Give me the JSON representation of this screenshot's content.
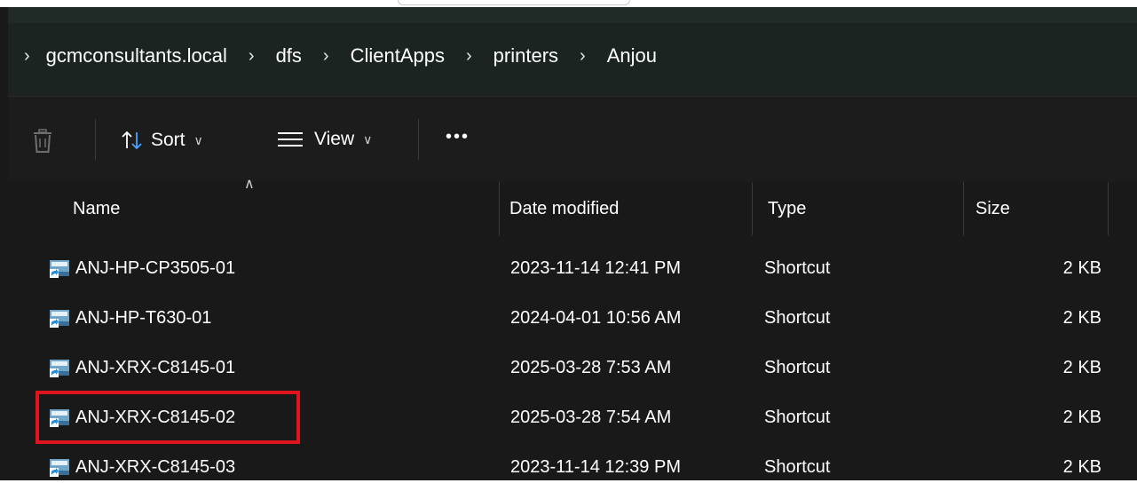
{
  "breadcrumb": {
    "segments": [
      "gcmconsultants.local",
      "dfs",
      "ClientApps",
      "printers",
      "Anjou"
    ]
  },
  "toolbar": {
    "sort_label": "Sort",
    "view_label": "View",
    "more_label": "•••"
  },
  "file_list": {
    "columns": {
      "name": "Name",
      "date": "Date modified",
      "type": "Type",
      "size": "Size"
    },
    "rows": [
      {
        "name": "ANJ-HP-CP3505-01",
        "date": "2023-11-14 12:41 PM",
        "type": "Shortcut",
        "size": "2 KB"
      },
      {
        "name": "ANJ-HP-T630-01",
        "date": "2024-04-01 10:56 AM",
        "type": "Shortcut",
        "size": "2 KB"
      },
      {
        "name": "ANJ-XRX-C8145-01",
        "date": "2025-03-28 7:53 AM",
        "type": "Shortcut",
        "size": "2 KB"
      },
      {
        "name": "ANJ-XRX-C8145-02",
        "date": "2025-03-28 7:54 AM",
        "type": "Shortcut",
        "size": "2 KB"
      },
      {
        "name": "ANJ-XRX-C8145-03",
        "date": "2023-11-14 12:39 PM",
        "type": "Shortcut",
        "size": "2 KB"
      }
    ],
    "highlighted_item": "ANJ-XRX-C8145-02"
  },
  "colors": {
    "window_bg": "#191919",
    "highlight": "#e0141c"
  }
}
